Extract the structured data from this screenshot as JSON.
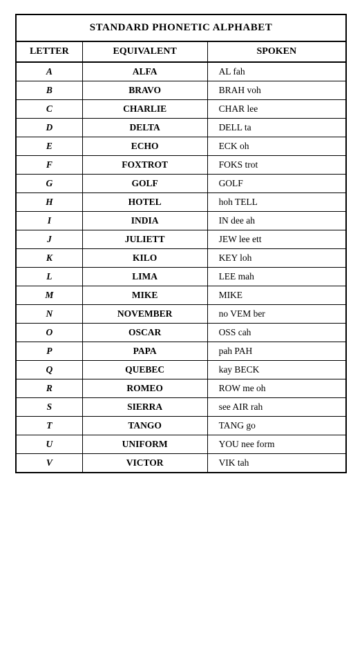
{
  "table": {
    "title": "STANDARD PHONETIC ALPHABET",
    "columns": [
      "LETTER",
      "EQUIVALENT",
      "SPOKEN"
    ],
    "rows": [
      {
        "letter": "A",
        "equivalent": "ALFA",
        "spoken": "AL fah"
      },
      {
        "letter": "B",
        "equivalent": "BRAVO",
        "spoken": "BRAH voh"
      },
      {
        "letter": "C",
        "equivalent": "CHARLIE",
        "spoken": "CHAR lee"
      },
      {
        "letter": "D",
        "equivalent": "DELTA",
        "spoken": "DELL ta"
      },
      {
        "letter": "E",
        "equivalent": "ECHO",
        "spoken": "ECK oh"
      },
      {
        "letter": "F",
        "equivalent": "FOXTROT",
        "spoken": "FOKS trot"
      },
      {
        "letter": "G",
        "equivalent": "GOLF",
        "spoken": "GOLF"
      },
      {
        "letter": "H",
        "equivalent": "HOTEL",
        "spoken": "hoh TELL"
      },
      {
        "letter": "I",
        "equivalent": "INDIA",
        "spoken": "IN dee ah"
      },
      {
        "letter": "J",
        "equivalent": "JULIETT",
        "spoken": "JEW lee ett"
      },
      {
        "letter": "K",
        "equivalent": "KILO",
        "spoken": "KEY loh"
      },
      {
        "letter": "L",
        "equivalent": "LIMA",
        "spoken": "LEE mah"
      },
      {
        "letter": "M",
        "equivalent": "MIKE",
        "spoken": "MIKE"
      },
      {
        "letter": "N",
        "equivalent": "NOVEMBER",
        "spoken": "no VEM ber"
      },
      {
        "letter": "O",
        "equivalent": "OSCAR",
        "spoken": "OSS cah"
      },
      {
        "letter": "P",
        "equivalent": "PAPA",
        "spoken": "pah PAH"
      },
      {
        "letter": "Q",
        "equivalent": "QUEBEC",
        "spoken": "kay BECK"
      },
      {
        "letter": "R",
        "equivalent": "ROMEO",
        "spoken": "ROW me oh"
      },
      {
        "letter": "S",
        "equivalent": "SIERRA",
        "spoken": "see AIR rah"
      },
      {
        "letter": "T",
        "equivalent": "TANGO",
        "spoken": "TANG go"
      },
      {
        "letter": "U",
        "equivalent": "UNIFORM",
        "spoken": "YOU nee form"
      },
      {
        "letter": "V",
        "equivalent": "VICTOR",
        "spoken": "VIK tah"
      }
    ]
  }
}
